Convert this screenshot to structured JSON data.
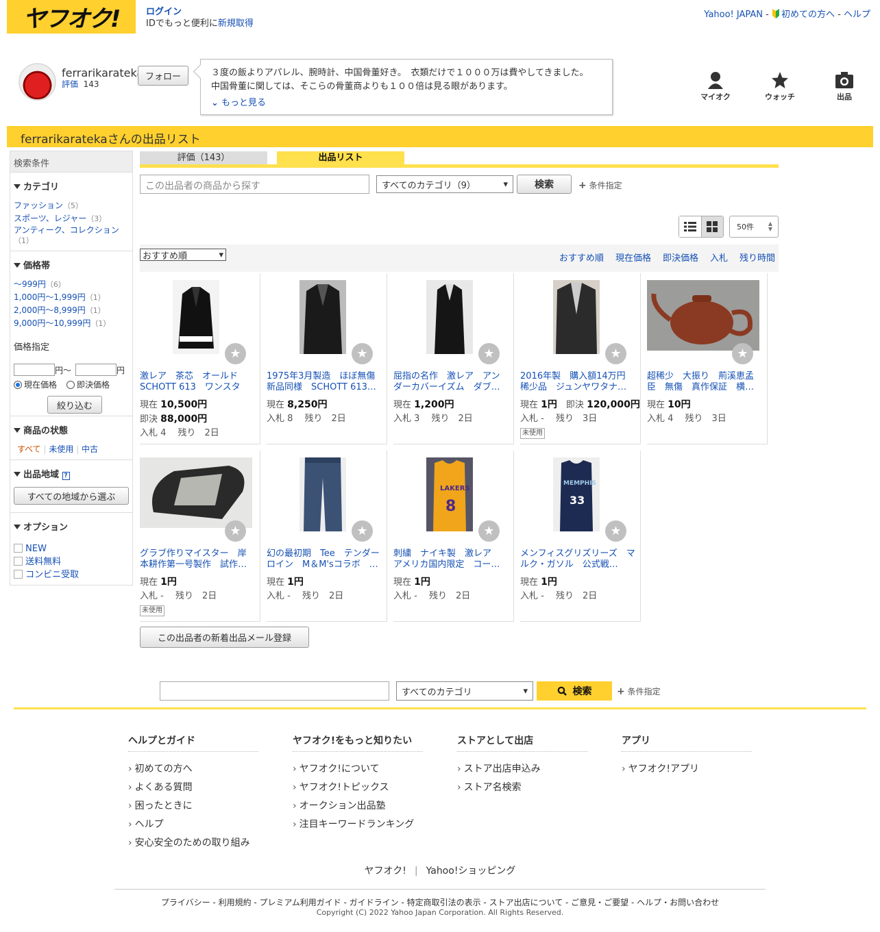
{
  "header": {
    "logo": "ヤフオク!",
    "login": "ログイン",
    "id_text": "IDでもっと便利に",
    "signup": "新規取得",
    "yahoo_japan": "Yahoo! JAPAN",
    "sep1": " - ",
    "beginner": "初めての方へ",
    "sep2": " - ",
    "help": "ヘルプ"
  },
  "seller": {
    "name": "ferrarikarateka",
    "rating_label": "評価",
    "rating": "143",
    "follow": "フォロー",
    "bio_line1": "３度の飯よりアパレル、腕時計、中国骨董好き。　衣類だけで１０００万は費やしてきました。",
    "bio_line2": "中国骨董に関しては、そこらの骨董商よりも１００倍は見る眼があります。",
    "more": "もっと見る"
  },
  "nav": {
    "myauc": "マイオク",
    "watch": "ウォッチ",
    "sell": "出品"
  },
  "banner": "ferrarikaratekaさんの出品リスト",
  "sidebar": {
    "header": "検索条件",
    "category_title": "カテゴリ",
    "categories": [
      {
        "name": "ファッション",
        "count": "（5）"
      },
      {
        "name": "スポーツ、レジャー",
        "count": "（3）"
      },
      {
        "name": "アンティーク、コレクション",
        "count": "（1）"
      }
    ],
    "price_title": "価格帯",
    "prices": [
      {
        "name": "〜999円",
        "count": "（6）"
      },
      {
        "name": "1,000円〜1,999円",
        "count": "（1）"
      },
      {
        "name": "2,000円〜8,999円",
        "count": "（1）"
      },
      {
        "name": "9,000円〜10,999円",
        "count": "（1）"
      }
    ],
    "price_spec": "価格指定",
    "yen_from": "円～",
    "yen_to": "円",
    "radio_current": "現在価格",
    "radio_buynow": "即決価格",
    "narrow": "絞り込む",
    "condition_title": "商品の状態",
    "cond_all": "すべて",
    "cond_unused": "未使用",
    "cond_used": "中古",
    "region_title": "出品地域",
    "region_btn": "すべての地域から選ぶ",
    "option_title": "オプション",
    "options": [
      "NEW",
      "送料無料",
      "コンビニ受取"
    ]
  },
  "tabs": {
    "rating": "評価（143）",
    "listing": "出品リスト"
  },
  "search": {
    "placeholder": "この出品者の商品から探す",
    "category": "すべてのカテゴリ（9）",
    "button": "検索",
    "cond": "条件指定"
  },
  "per_page": "50件",
  "sort": {
    "selected": "おすすめ順",
    "links": [
      "おすすめ順",
      "現在価格",
      "即決価格",
      "入札",
      "残り時間"
    ]
  },
  "items": [
    {
      "title": "激レア　茶芯　オールド SCHOTT 613　ワンスター　…",
      "l1": "現在",
      "v1": "10,500円",
      "l2": "即決",
      "v2": "88,000円",
      "bids": "入札 4　 残り　2日",
      "unused": ""
    },
    {
      "title": "1975年3月製造　ほぼ無傷 新品同様　SCHOTT 613…",
      "l1": "現在",
      "v1": "8,250円",
      "l2": "",
      "v2": "",
      "bids": "入札 8　 残り　2日",
      "unused": ""
    },
    {
      "title": "屈指の名作　激レア　アンダーカバーイズム　ダブ…",
      "l1": "現在",
      "v1": "1,200円",
      "l2": "",
      "v2": "",
      "bids": "入札 3　 残り　2日",
      "unused": ""
    },
    {
      "title": "2016年製　購入額14万円　稀少品　ジュンヤワタナ…",
      "l1": "現在",
      "v1": "1円",
      "l2": "即決",
      "v2": "120,000円",
      "bids": "入札 -　 残り　3日",
      "unused": "未使用"
    },
    {
      "title": "超稀少　大振り　荊溪恵孟臣　無傷　真作保証　横…",
      "l1": "現在",
      "v1": "10円",
      "l2": "",
      "v2": "",
      "bids": "入札 4　 残り　3日",
      "unused": ""
    },
    {
      "title": "グラブ作りマイスター　岸本耕作第一号製作　試作…",
      "l1": "現在",
      "v1": "1円",
      "l2": "",
      "v2": "",
      "bids": "入札 -　 残り　2日",
      "unused": "未使用"
    },
    {
      "title": "幻の最初期　Tee　テンダーロイン　M＆M'sコラボ　…",
      "l1": "現在",
      "v1": "1円",
      "l2": "",
      "v2": "",
      "bids": "入札 -　 残り　2日",
      "unused": ""
    },
    {
      "title": "刺繍　ナイキ製　激レア　アメリカ国内限定　コー…",
      "l1": "現在",
      "v1": "1円",
      "l2": "",
      "v2": "",
      "bids": "入札 -　 残り　2日",
      "unused": ""
    },
    {
      "title": "メンフィスグリズリーズ　マルク・ガソル　公式戦…",
      "l1": "現在",
      "v1": "1円",
      "l2": "",
      "v2": "",
      "bids": "入札 -　 残り　2日",
      "unused": ""
    }
  ],
  "mail_register": "この出品者の新着出品メール登録",
  "bottom_search": {
    "category": "すべてのカテゴリ",
    "button": "検索",
    "cond": "条件指定"
  },
  "footer": {
    "cols": [
      {
        "title": "ヘルプとガイド",
        "items": [
          "初めての方へ",
          "よくある質問",
          "困ったときに",
          "ヘルプ",
          "安心安全のための取り組み"
        ]
      },
      {
        "title": "ヤフオク!をもっと知りたい",
        "items": [
          "ヤフオク!について",
          "ヤフオク!トピックス",
          "オークション出品塾",
          "注目キーワードランキング"
        ]
      },
      {
        "title": "ストアとして出店",
        "items": [
          "ストア出店申込み",
          "ストア名検索"
        ]
      },
      {
        "title": "アプリ",
        "items": [
          "ヤフオク!アプリ"
        ]
      }
    ],
    "svc1": "ヤフオク!",
    "svc2": "Yahoo!ショッピング",
    "links": "プライバシー - 利用規約 - プレミアム利用ガイド - ガイドライン - 特定商取引法の表示 - ストア出店について - ご意見・ご要望 - ヘルプ・お問い合わせ",
    "copyright": "Copyright (C) 2022 Yahoo Japan Corporation. All Rights Reserved."
  },
  "colors": {
    "brand_yellow": "#ffd02e",
    "link_blue": "#1550b4"
  }
}
